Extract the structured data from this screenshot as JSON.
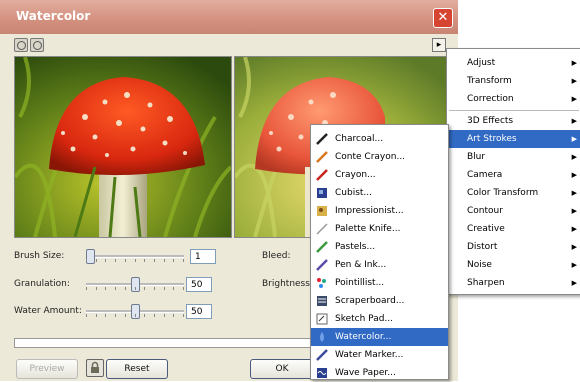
{
  "window": {
    "title": "Watercolor",
    "close_glyph": "✕",
    "options_glyph": "▸"
  },
  "controls": {
    "brush_size": {
      "label": "Brush Size:",
      "value": "1",
      "fraction": 0.0
    },
    "granulation": {
      "label": "Granulation:",
      "value": "50",
      "fraction": 0.5
    },
    "water_amount": {
      "label": "Water Amount:",
      "value": "50",
      "fraction": 0.5
    },
    "bleed": {
      "label": "Bleed:"
    },
    "brightness": {
      "label": "Brightness"
    }
  },
  "buttons": {
    "preview": "Preview",
    "reset": "Reset",
    "ok": "OK"
  },
  "effects_menu": {
    "items": [
      {
        "label": "Adjust",
        "has_submenu": true
      },
      {
        "label": "Transform",
        "has_submenu": true
      },
      {
        "label": "Correction",
        "has_submenu": true
      },
      {
        "label": "3D Effects",
        "has_submenu": true
      },
      {
        "label": "Art Strokes",
        "has_submenu": true,
        "selected": true
      },
      {
        "label": "Blur",
        "has_submenu": true
      },
      {
        "label": "Camera",
        "has_submenu": true
      },
      {
        "label": "Color Transform",
        "has_submenu": true
      },
      {
        "label": "Contour",
        "has_submenu": true
      },
      {
        "label": "Creative",
        "has_submenu": true
      },
      {
        "label": "Distort",
        "has_submenu": true
      },
      {
        "label": "Noise",
        "has_submenu": true
      },
      {
        "label": "Sharpen",
        "has_submenu": true
      }
    ]
  },
  "art_strokes_menu": {
    "items": [
      {
        "label": "Charcoal...",
        "icon": "charcoal-icon"
      },
      {
        "label": "Conte Crayon...",
        "icon": "conte-crayon-icon"
      },
      {
        "label": "Crayon...",
        "icon": "crayon-icon"
      },
      {
        "label": "Cubist...",
        "icon": "cubist-icon"
      },
      {
        "label": "Impressionist...",
        "icon": "impressionist-icon"
      },
      {
        "label": "Palette Knife...",
        "icon": "palette-knife-icon"
      },
      {
        "label": "Pastels...",
        "icon": "pastels-icon"
      },
      {
        "label": "Pen & Ink...",
        "icon": "pen-ink-icon"
      },
      {
        "label": "Pointillist...",
        "icon": "pointillist-icon"
      },
      {
        "label": "Scraperboard...",
        "icon": "scraperboard-icon"
      },
      {
        "label": "Sketch Pad...",
        "icon": "sketch-pad-icon"
      },
      {
        "label": "Watercolor...",
        "icon": "watercolor-icon",
        "selected": true
      },
      {
        "label": "Water Marker...",
        "icon": "water-marker-icon"
      },
      {
        "label": "Wave Paper...",
        "icon": "wave-paper-icon"
      }
    ]
  },
  "colors": {
    "title_bar": "#d4907e",
    "selection": "#316ac5",
    "dialog": "#ece9d8"
  }
}
